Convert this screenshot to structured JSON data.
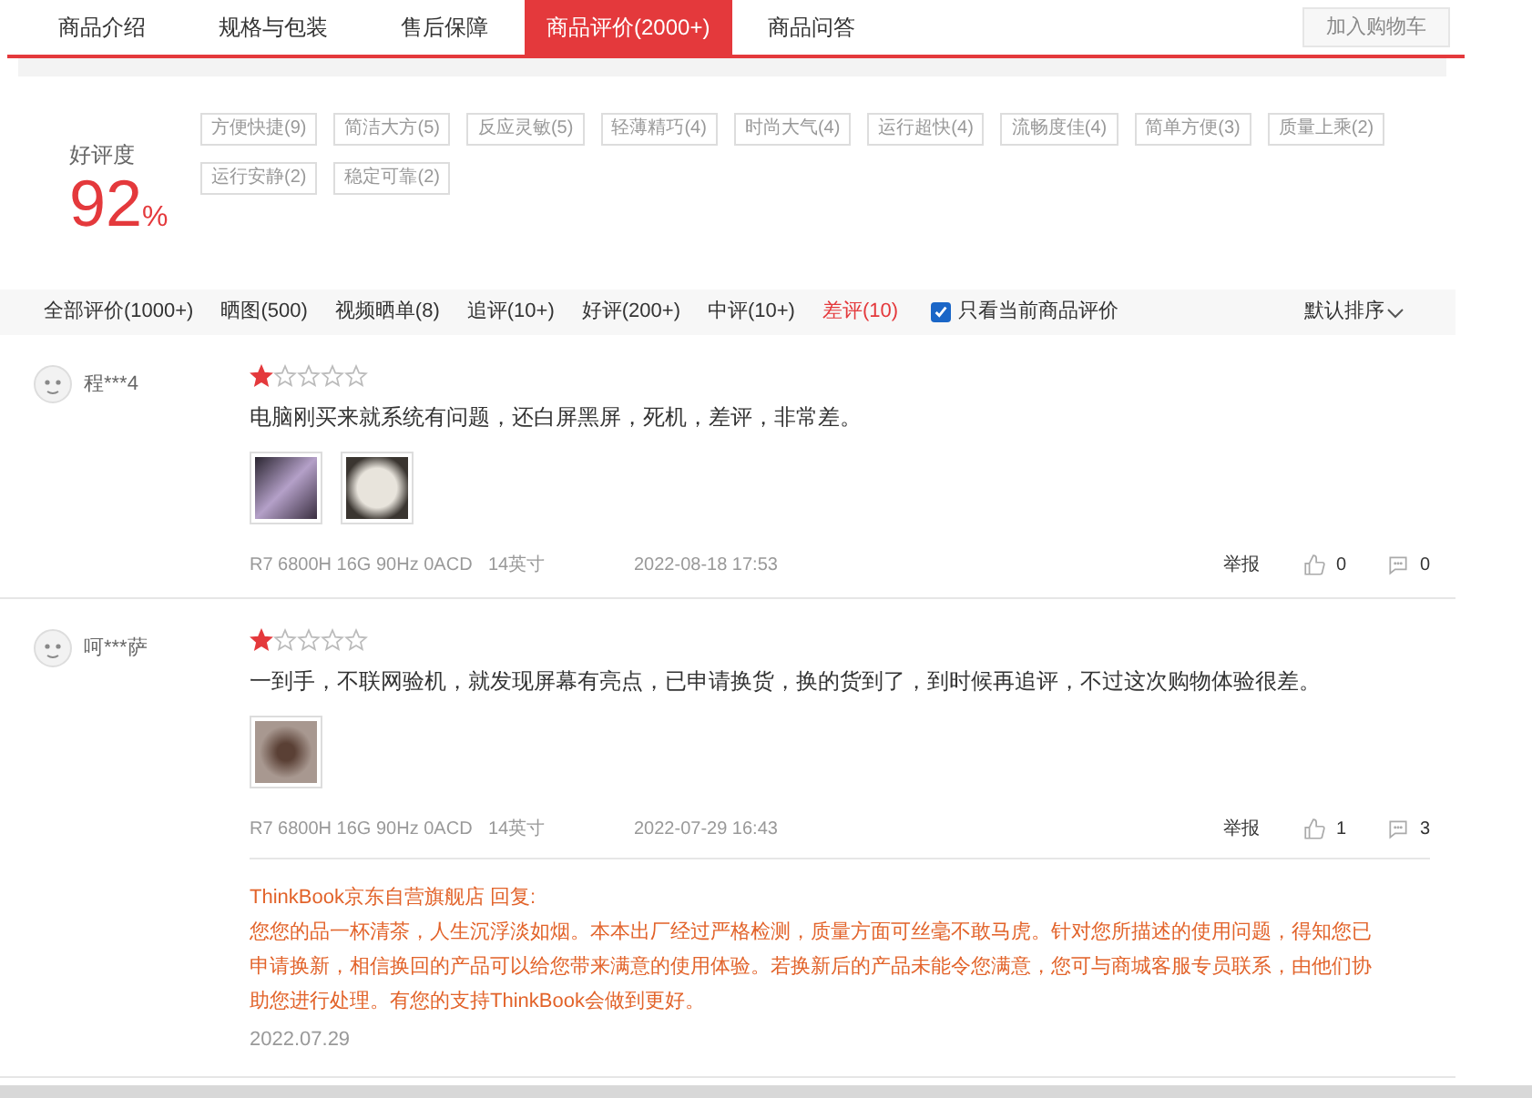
{
  "tabs": [
    {
      "label": "商品介绍",
      "selected": false
    },
    {
      "label": "规格与包装",
      "selected": false
    },
    {
      "label": "售后保障",
      "selected": false
    },
    {
      "label": "商品评价(2000+)",
      "selected": true
    },
    {
      "label": "商品问答",
      "selected": false
    }
  ],
  "cart_button": {
    "label": "加入购物车",
    "disabled": true
  },
  "rating": {
    "label": "好评度",
    "value": "92",
    "unit": "%"
  },
  "tags": [
    "方便快捷(9)",
    "简洁大方(5)",
    "反应灵敏(5)",
    "轻薄精巧(4)",
    "时尚大气(4)",
    "运行超快(4)",
    "流畅度佳(4)",
    "简单方便(3)",
    "质量上乘(2)",
    "运行安静(2)",
    "稳定可靠(2)"
  ],
  "filters": [
    {
      "label": "全部评价(1000+)",
      "selected": false
    },
    {
      "label": "晒图(500)",
      "selected": false
    },
    {
      "label": "视频晒单(8)",
      "selected": false
    },
    {
      "label": "追评(10+)",
      "selected": false
    },
    {
      "label": "好评(200+)",
      "selected": false
    },
    {
      "label": "中评(10+)",
      "selected": false
    },
    {
      "label": "差评(10)",
      "selected": true
    }
  ],
  "only_current": {
    "label": "只看当前商品评价",
    "checked": true
  },
  "sort": {
    "label": "默认排序"
  },
  "reviews": [
    {
      "user": "程***4",
      "stars": 1,
      "text": "电脑刚买来就系统有问题，还白屏黑屏，死机，差评，非常差。",
      "photos": [
        {
          "kind": "screen"
        },
        {
          "kind": "panel"
        }
      ],
      "spec": "R7 6800H 16G 90Hz 0ACD",
      "size": "14英寸",
      "date": "2022-08-18 17:53",
      "report": "举报",
      "likes": "0",
      "comments": "0"
    },
    {
      "user": "呵***萨",
      "stars": 1,
      "text": "一到手，不联网验机，就发现屏幕有亮点，已申请换货，换的货到了，到时候再追评，不过这次购物体验很差。",
      "photos": [
        {
          "kind": "blur"
        }
      ],
      "spec": "R7 6800H 16G 90Hz 0ACD",
      "size": "14英寸",
      "date": "2022-07-29 16:43",
      "report": "举报",
      "likes": "1",
      "comments": "3",
      "reply": {
        "header": "ThinkBook京东自营旗舰店 回复:",
        "text": "您您的品一杯清茶，人生沉浮淡如烟。本本出厂经过严格检测，质量方面可丝毫不敢马虎。针对您所描述的使用问题，得知您已申请换新，相信换回的产品可以给您带来满意的使用体验。若换新后的产品未能令您满意，您可与商城客服专员联系，由他们协助您进行处理。有您的支持ThinkBook会做到更好。",
        "date": "2022.07.29"
      }
    }
  ]
}
